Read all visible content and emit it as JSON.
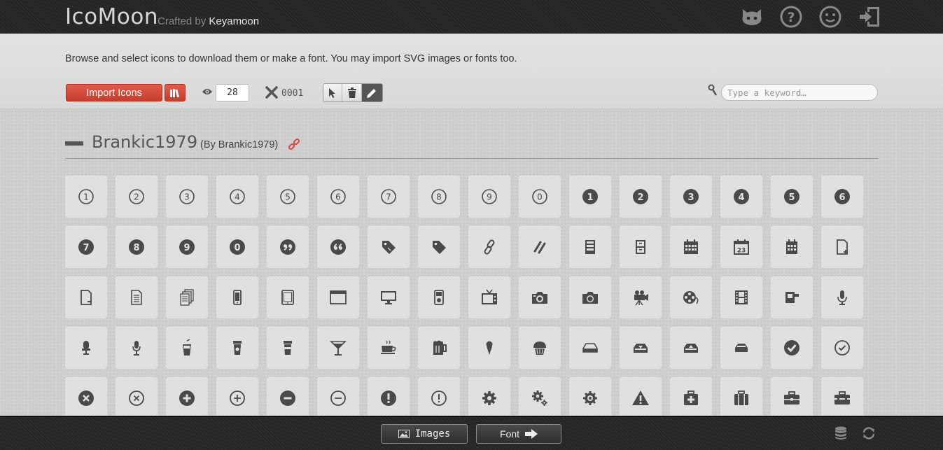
{
  "header": {
    "logo": "IcoMoon",
    "crafted_prefix": "Crafted by",
    "crafted_author": "Keyamoon",
    "icons": [
      "github-icon",
      "help-icon",
      "smiley-icon",
      "signout-icon"
    ]
  },
  "toolbar": {
    "intro": "Browse and select icons to download them or make a font. You may import SVG images or fonts too.",
    "import_label": "Import Icons",
    "size_value": "28",
    "counter": "0001",
    "search_placeholder": "Type a keyword…",
    "modes": [
      "select-icon",
      "delete-icon",
      "edit-icon"
    ],
    "active_mode": "edit-icon"
  },
  "icon_set": {
    "title": "Brankic1979",
    "by_prefix": "(By",
    "by_author": "Brankic1979",
    "by_suffix": ")"
  },
  "bottom": {
    "images_label": "Images",
    "font_label": "Font"
  },
  "colors": {
    "accent_red": "#d34b3b",
    "header_bg": "#252525",
    "icon_fill": "#4a4a4a"
  }
}
